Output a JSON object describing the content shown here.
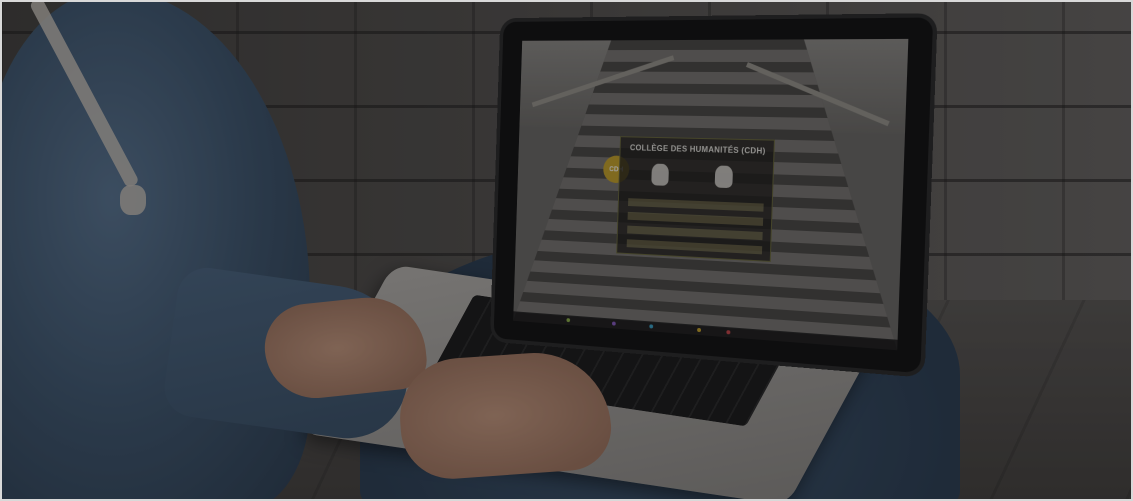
{
  "image": {
    "description": "",
    "screen": {
      "badge": "CDH",
      "panel_title": "COLLÈGE DES HUMANITÉS (CDH)"
    },
    "colors": {
      "badge": "#c9a52a",
      "overlay": "rgba(10,10,12,0.38)"
    }
  }
}
